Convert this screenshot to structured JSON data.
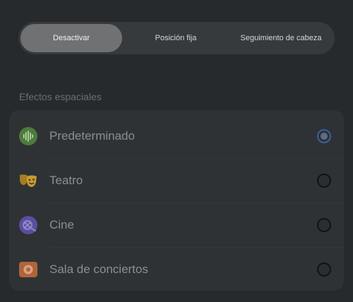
{
  "tabs": [
    {
      "label": "Desactivar",
      "selected": true
    },
    {
      "label": "Posición fija",
      "selected": false
    },
    {
      "label": "Seguimiento de cabeza",
      "selected": false
    }
  ],
  "section": {
    "title": "Efectos espaciales"
  },
  "effects": [
    {
      "label": "Predeterminado",
      "icon": "soundwave-icon",
      "selected": true
    },
    {
      "label": "Teatro",
      "icon": "theater-masks-icon",
      "selected": false
    },
    {
      "label": "Cine",
      "icon": "film-reel-icon",
      "selected": false
    },
    {
      "label": "Sala de conciertos",
      "icon": "concert-hall-icon",
      "selected": false
    }
  ],
  "colors": {
    "background": "#262a2d",
    "card": "#2e3235",
    "selected_tab": "#6f7173",
    "radio_accent": "#3d5f9a"
  }
}
